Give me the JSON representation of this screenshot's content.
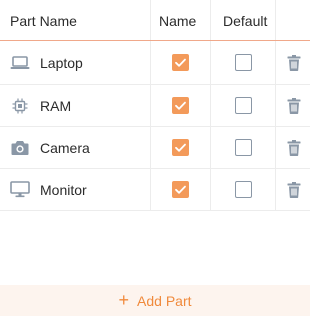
{
  "header": {
    "part_name": "Part Name",
    "name": "Name",
    "default": "Default"
  },
  "rows": [
    {
      "label": "Laptop",
      "icon": "laptop-icon",
      "name_checked": true,
      "default_checked": false
    },
    {
      "label": "RAM",
      "icon": "chip-icon",
      "name_checked": true,
      "default_checked": false
    },
    {
      "label": "Camera",
      "icon": "camera-icon",
      "name_checked": true,
      "default_checked": false
    },
    {
      "label": "Monitor",
      "icon": "monitor-icon",
      "name_checked": true,
      "default_checked": false
    }
  ],
  "footer": {
    "plus": "+",
    "add_label": "Add Part"
  },
  "colors": {
    "accent": "#f08a3c",
    "checkbox_fill": "#f39a5a",
    "header_rule": "#f0a88a",
    "icon_gray": "#8a97a6",
    "footer_bg": "#fdf4ee"
  }
}
